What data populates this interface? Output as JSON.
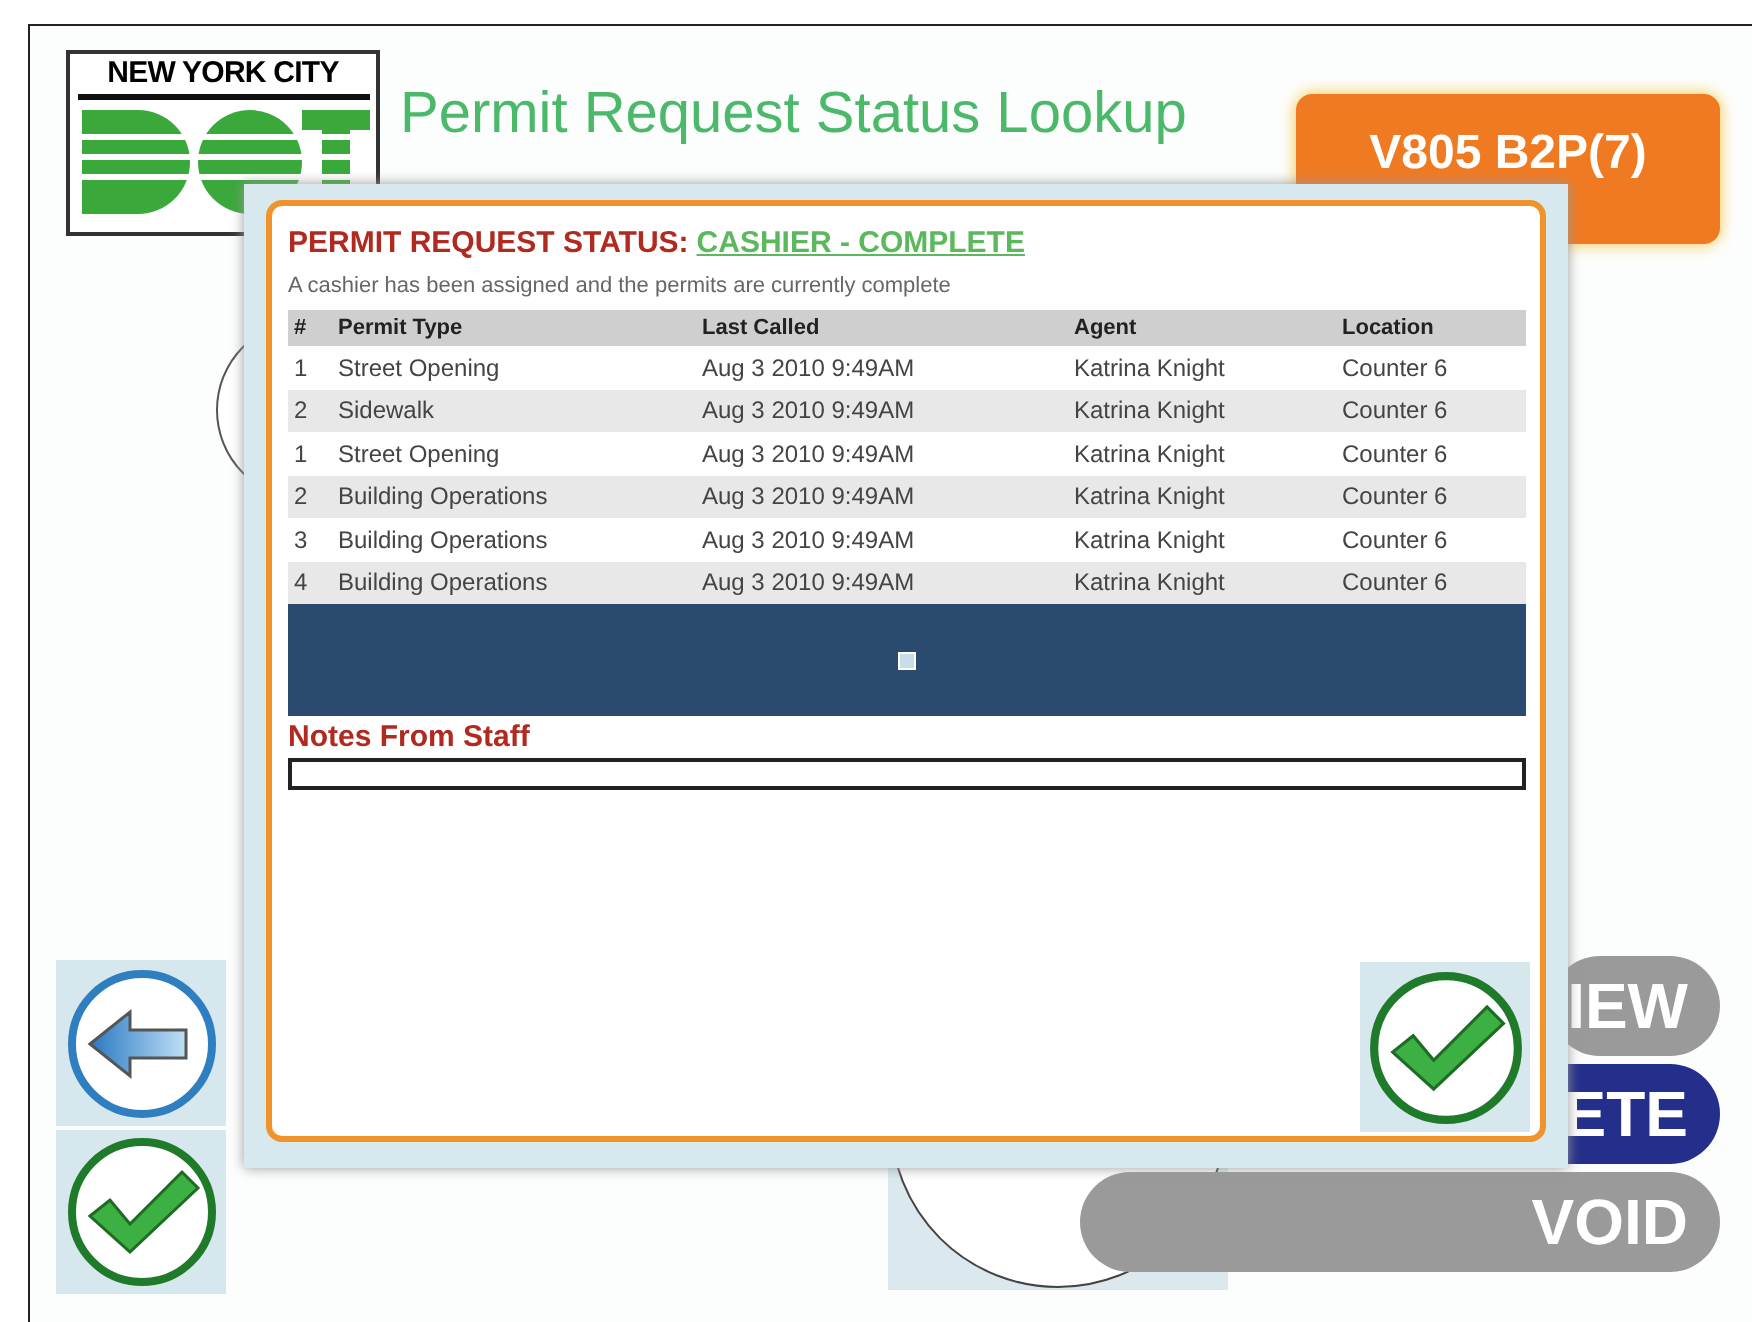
{
  "logo": {
    "text": "NEW YORK CITY"
  },
  "title": "Permit Request Status Lookup",
  "badge": "V805 B2P(7)",
  "action_buttons": [
    {
      "label": "IEW",
      "kind": "gray"
    },
    {
      "label": "ETE",
      "kind": "navy"
    },
    {
      "label": "VOID",
      "kind": "gray"
    }
  ],
  "dialog": {
    "heading": "PERMIT REQUEST STATUS:",
    "status": "CASHIER - COMPLETE",
    "description": "A cashier has been assigned and the permits are currently complete",
    "table": {
      "columns": [
        "#",
        "Permit Type",
        "Last Called",
        "Agent",
        "Location"
      ],
      "rows": [
        [
          "1",
          "Street Opening",
          "Aug 3 2010 9:49AM",
          "Katrina Knight",
          "Counter 6"
        ],
        [
          "2",
          "Sidewalk",
          "Aug 3 2010 9:49AM",
          "Katrina Knight",
          "Counter 6"
        ],
        [
          "1",
          "Street Opening",
          "Aug 3 2010 9:49AM",
          "Katrina Knight",
          "Counter 6"
        ],
        [
          "2",
          "Building Operations",
          "Aug 3 2010 9:49AM",
          "Katrina Knight",
          "Counter 6"
        ],
        [
          "3",
          "Building Operations",
          "Aug 3 2010 9:49AM",
          "Katrina Knight",
          "Counter 6"
        ],
        [
          "4",
          "Building Operations",
          "Aug 3 2010 9:49AM",
          "Katrina Knight",
          "Counter 6"
        ]
      ]
    },
    "notes_label": "Notes From Staff"
  }
}
